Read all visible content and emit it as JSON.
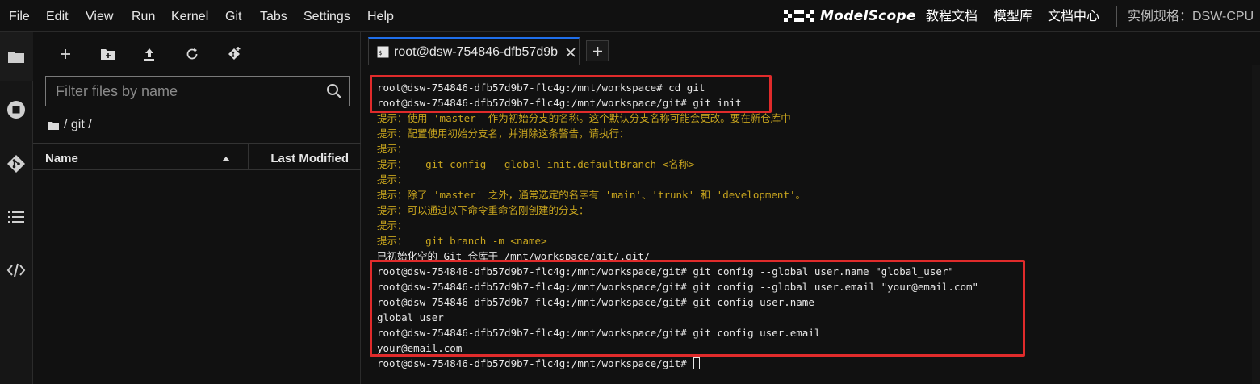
{
  "menu": [
    "File",
    "Edit",
    "View",
    "Run",
    "Kernel",
    "Git",
    "Tabs",
    "Settings",
    "Help"
  ],
  "brand": {
    "name": "ModelScope",
    "icon": "modelscope-logo-icon"
  },
  "top_links": [
    "教程文档",
    "模型库",
    "文档中心"
  ],
  "instance_spec": "实例规格：DSW-CPU",
  "activity_bar": [
    {
      "icon": "folder-icon"
    },
    {
      "icon": "running-stop-icon"
    },
    {
      "icon": "git-icon"
    },
    {
      "icon": "table-of-contents-icon"
    },
    {
      "icon": "code-icon"
    }
  ],
  "file_browser": {
    "toolbar": [
      "new-launcher-plus-icon",
      "new-folder-icon",
      "upload-icon",
      "refresh-icon",
      "git-clone-icon"
    ],
    "search_placeholder": "Filter files by name",
    "breadcrumb": "/ git /",
    "columns": {
      "name": "Name",
      "last_modified": "Last Modified"
    }
  },
  "tab": {
    "label": "root@dsw-754846-dfb57d9b",
    "icon": "terminal-icon"
  },
  "terminal_lines": [
    {
      "text": "root@dsw-754846-dfb57d9b7-flc4g:/mnt/workspace# cd git",
      "color": "white"
    },
    {
      "text": "root@dsw-754846-dfb57d9b7-flc4g:/mnt/workspace/git# git init",
      "color": "white"
    },
    {
      "text": "提示：使用 'master' 作为初始分支的名称。这个默认分支名称可能会更改。要在新仓库中",
      "color": "yellow"
    },
    {
      "text": "提示：配置使用初始分支名，并消除这条警告，请执行：",
      "color": "yellow"
    },
    {
      "text": "提示：",
      "color": "yellow"
    },
    {
      "text": "提示：   git config --global init.defaultBranch <名称>",
      "color": "yellow"
    },
    {
      "text": "提示：",
      "color": "yellow"
    },
    {
      "text": "提示：除了 'master' 之外，通常选定的名字有 'main'、'trunk' 和 'development'。",
      "color": "yellow"
    },
    {
      "text": "提示：可以通过以下命令重命名刚创建的分支：",
      "color": "yellow"
    },
    {
      "text": "提示：",
      "color": "yellow"
    },
    {
      "text": "提示：   git branch -m <name>",
      "color": "yellow"
    },
    {
      "text": "已初始化空的 Git 仓库于 /mnt/workspace/git/.git/",
      "color": "white"
    },
    {
      "text": "root@dsw-754846-dfb57d9b7-flc4g:/mnt/workspace/git# git config --global user.name \"global_user\"",
      "color": "white"
    },
    {
      "text": "root@dsw-754846-dfb57d9b7-flc4g:/mnt/workspace/git# git config --global user.email \"your@email.com\"",
      "color": "white"
    },
    {
      "text": "root@dsw-754846-dfb57d9b7-flc4g:/mnt/workspace/git# git config user.name",
      "color": "white"
    },
    {
      "text": "global_user",
      "color": "white"
    },
    {
      "text": "root@dsw-754846-dfb57d9b7-flc4g:/mnt/workspace/git# git config user.email",
      "color": "white"
    },
    {
      "text": "your@email.com",
      "color": "white"
    },
    {
      "text": "root@dsw-754846-dfb57d9b7-flc4g:/mnt/workspace/git# ",
      "color": "white"
    }
  ],
  "colors": {
    "highlight": "#e02b2b",
    "hint_text": "#c8a51e",
    "tab_accent": "#1f6feb"
  }
}
